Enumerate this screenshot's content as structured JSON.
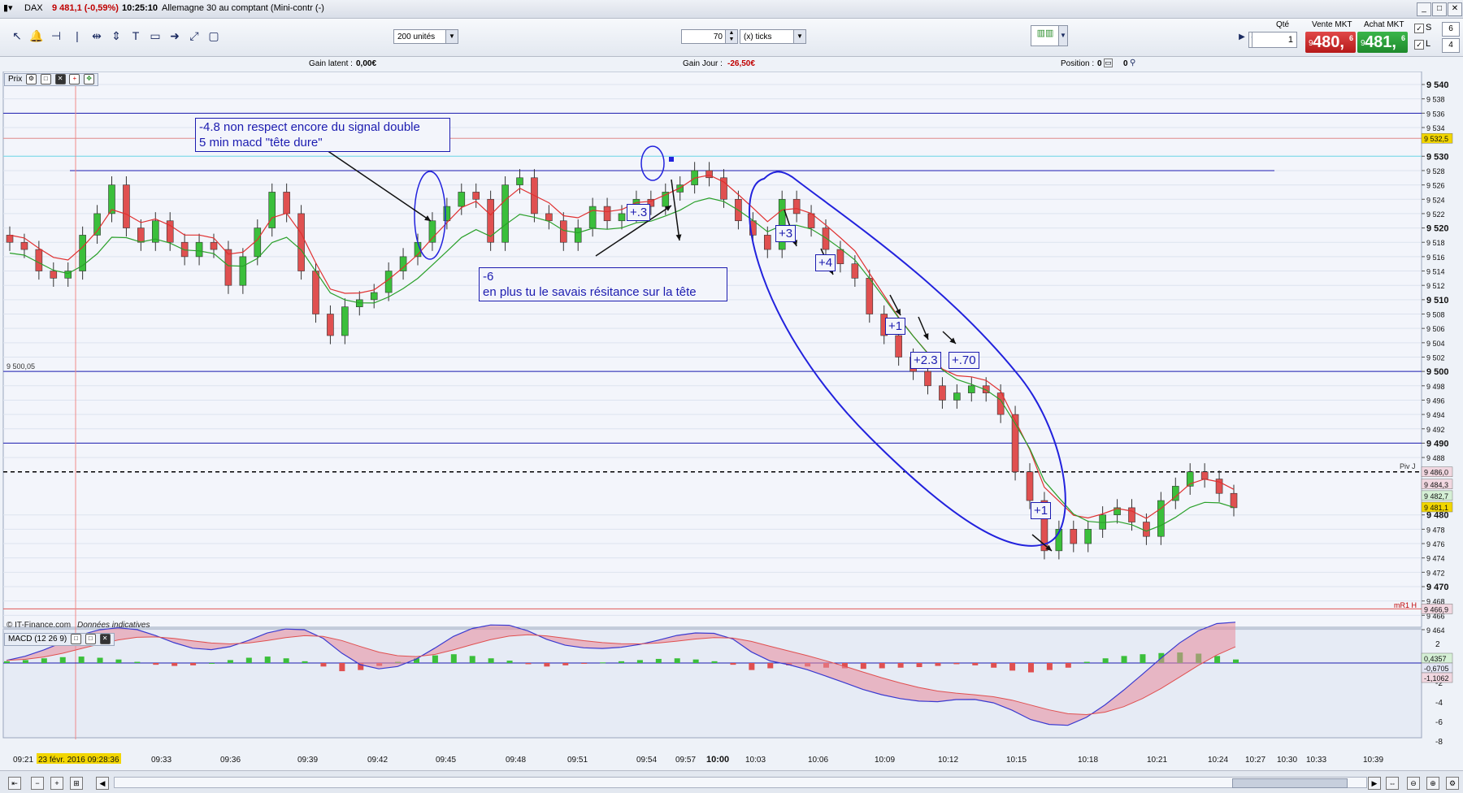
{
  "titlebar": {
    "instrument": "DAX",
    "price_change": "9 481,1 (-0,59%)",
    "time": "10:25:10",
    "description": "Allemagne 30 au comptant (Mini-contr (-)"
  },
  "toolbar": {
    "units_select": "200 unités",
    "ticks_value": "70",
    "ticks_select": "(x) ticks",
    "qty_label": "Qté",
    "qty_value": "1",
    "sell_label": "Vente MKT",
    "sell_price_small": "9",
    "sell_price_big": "480,",
    "sell_price_sup": "6",
    "buy_label": "Achat MKT",
    "buy_price_small": "9",
    "buy_price_big": "481,",
    "buy_price_sup": "6",
    "s_label": "S",
    "s_value": "6",
    "l_label": "L",
    "l_value": "4"
  },
  "infobar": {
    "gain_latent_label": "Gain latent :",
    "gain_latent_value": "0,00€",
    "gain_jour_label": "Gain Jour :",
    "gain_jour_value": "-26,50€",
    "position_label": "Position :",
    "position_value_1": "0",
    "position_value_2": "0"
  },
  "price_panel": {
    "label": "Prix",
    "source": "© IT-Finance.com",
    "source_note": "Données indicatives",
    "level_label": "9 500,05",
    "piv_label": "Piv J",
    "mr1_label": "mR1 H"
  },
  "macd_panel": {
    "label": "MACD (12 26 9)"
  },
  "annotations": {
    "note1_line1": "-4.8 non respect encore du signal double",
    "note1_line2": "5 min macd \"tête dure\"",
    "note2_line1": "-6",
    "note2_line2": "en plus tu le savais résitance sur la tête",
    "tag_p3a": "+.3",
    "tag_p3": "+3",
    "tag_p4": "+4",
    "tag_p1a": "+1",
    "tag_p23": "+2.3",
    "tag_p70": "+.70",
    "tag_p1b": "+1"
  },
  "price_axis": {
    "ticks": [
      "9 540",
      "9 538",
      "9 536",
      "9 534",
      "9 530",
      "9 528",
      "9 526",
      "9 524",
      "9 522",
      "9 520",
      "9 518",
      "9 516",
      "9 514",
      "9 512",
      "9 510",
      "9 508",
      "9 506",
      "9 504",
      "9 502",
      "9 500",
      "9 498",
      "9 496",
      "9 494",
      "9 492",
      "9 490",
      "9 488",
      "9 480",
      "9 478",
      "9 476",
      "9 474",
      "9 472",
      "9 470",
      "9 468",
      "9 466",
      "9 464"
    ],
    "tick_values": [
      9540,
      9538,
      9536,
      9534,
      9530,
      9528,
      9526,
      9524,
      9522,
      9520,
      9518,
      9516,
      9514,
      9512,
      9510,
      9508,
      9506,
      9504,
      9502,
      9500,
      9498,
      9496,
      9494,
      9492,
      9490,
      9488,
      9480,
      9478,
      9476,
      9474,
      9472,
      9470,
      9468,
      9466,
      9464
    ],
    "bold_values": [
      9540,
      9530,
      9520,
      9510,
      9500,
      9490,
      9480,
      9470
    ],
    "markers": [
      {
        "value": 9532.5,
        "label": "9 532,5",
        "color": "#f2d600"
      },
      {
        "value": 9486.0,
        "label": "9 486,0",
        "color": "#f1d7e0"
      },
      {
        "value": 9484.3,
        "label": "9 484,3",
        "color": "#f1d7e0"
      },
      {
        "value": 9482.7,
        "label": "9 482,7",
        "color": "#d5f0d5"
      },
      {
        "value": 9481.1,
        "label": "9 481,1",
        "color": "#f2d600"
      },
      {
        "value": 9466.9,
        "label": "9 466,9",
        "color": "#f1d7e0"
      }
    ],
    "range": [
      9464,
      9542
    ]
  },
  "macd_axis": {
    "ticks": [
      "2",
      "0",
      "-2",
      "-4",
      "-6",
      "-8"
    ],
    "tick_values": [
      2,
      0,
      -2,
      -4,
      -6,
      -8
    ],
    "markers": [
      {
        "value": 0.4357,
        "label": "0,4357",
        "color": "#d5f0d5"
      },
      {
        "value": -0.6705,
        "label": "-0,6705",
        "color": "#e3e6f5"
      },
      {
        "value": -1.1062,
        "label": "-1,1062",
        "color": "#f1d7e0"
      }
    ],
    "range": [
      -8.6,
      2.8
    ]
  },
  "time_axis": {
    "labels": [
      "09:21",
      "23 févr. 2016 09:28:36",
      "09:33",
      "09:36",
      "09:39",
      "09:42",
      "09:45",
      "09:48",
      "09:51",
      "09:54",
      "09:57",
      "10:00",
      "10:03",
      "10:06",
      "10:09",
      "10:12",
      "10:15",
      "10:18",
      "10:21",
      "10:24",
      "10:27",
      "10:30",
      "10:33",
      "10:39"
    ]
  },
  "chart_data": {
    "type": "candlestick",
    "interval": "15 seconds",
    "horizontal_lines": [
      9536,
      9532.5,
      9530,
      9528,
      9500,
      9490,
      9486,
      9466.9
    ],
    "price_close_series": [
      9518,
      9517,
      9514,
      9513,
      9514,
      9519,
      9522,
      9526,
      9520,
      9518,
      9521,
      9518,
      9516,
      9518,
      9517,
      9512,
      9516,
      9520,
      9525,
      9522,
      9514,
      9508,
      9505,
      9509,
      9510,
      9511,
      9514,
      9516,
      9518,
      9521,
      9523,
      9525,
      9524,
      9518,
      9526,
      9527,
      9522,
      9521,
      9518,
      9520,
      9523,
      9521,
      9522,
      9524,
      9523,
      9525,
      9526,
      9528,
      9527,
      9524,
      9521,
      9519,
      9517,
      9524,
      9522,
      9520,
      9517,
      9515,
      9513,
      9508,
      9505,
      9502,
      9500,
      9498,
      9496,
      9497,
      9498,
      9497,
      9494,
      9486,
      9482,
      9475,
      9478,
      9476,
      9478,
      9480,
      9481,
      9479,
      9477,
      9482,
      9484,
      9486,
      9485,
      9483,
      9481
    ],
    "macd_histogram_series": [
      0.3,
      0.5,
      0.8,
      1.0,
      1.1,
      0.9,
      0.6,
      0.2,
      -0.3,
      -0.5,
      -0.4,
      0.0,
      0.5,
      0.9,
      1.1,
      0.8,
      0.3,
      -0.6,
      -1.4,
      -1.2,
      -0.5,
      0.2,
      0.8,
      1.3,
      1.5,
      1.2,
      0.8,
      0.4,
      -0.2,
      -0.6,
      -0.4,
      -0.1,
      0.1,
      0.3,
      0.5,
      0.7,
      0.8,
      0.6,
      0.3,
      -0.3,
      -1.2,
      -0.9,
      -0.4,
      -0.6,
      -0.8,
      -0.9,
      -1.0,
      -0.9,
      -0.8,
      -0.7,
      -0.5,
      -0.2,
      -0.4,
      -0.8,
      -1.3,
      -1.6,
      -1.2,
      -0.8,
      0.2,
      0.8,
      1.2,
      1.5,
      1.7,
      1.8,
      1.6,
      1.2,
      0.6
    ],
    "ylabel": "",
    "xlabel": ""
  }
}
